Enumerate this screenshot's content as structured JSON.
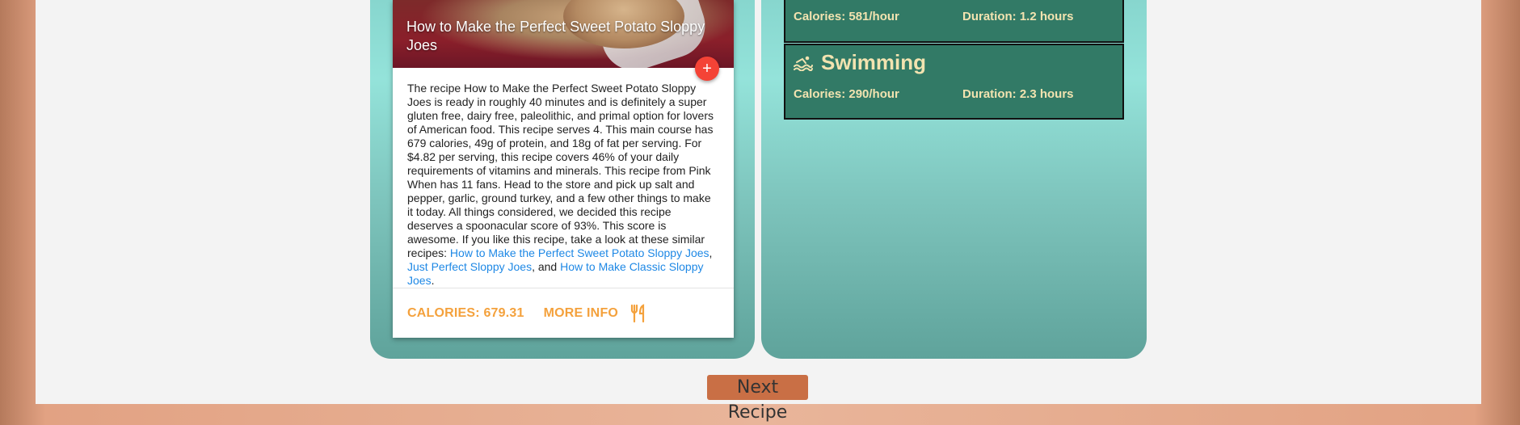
{
  "recipe": {
    "title": "How to Make the Perfect Sweet Potato Sloppy Joes",
    "add_button": "+",
    "summary_text": "The recipe How to Make the Perfect Sweet Potato Sloppy Joes is ready in roughly 40 minutes and is definitely a super gluten free, dairy free, paleolithic, and primal option for lovers of American food. This recipe serves 4. This main course has 679 calories, 49g of protein, and 18g of fat per serving. For $4.82 per serving, this recipe covers 46% of your daily requirements of vitamins and minerals. This recipe from Pink When has 11 fans. Head to the store and pick up salt and pepper, garlic, ground turkey, and a few other things to make it today. All things considered, we decided this recipe deserves a spoonacular score of 93%. This score is awesome. If you like this recipe, take a look at these similar recipes:",
    "similar_links": [
      "How to Make the Perfect Sweet Potato Sloppy Joes",
      "Just Perfect Sloppy Joes",
      "How to Make Classic Sloppy Joes"
    ],
    "sep1": ",",
    "sep2": ", and",
    "sep3": ".",
    "calories_label": "CALORIES: 679.31",
    "more_info_label": "MORE INFO",
    "fork_icon": "fork-knife-icon"
  },
  "exercises": [
    {
      "name": "",
      "calories": "Calories: 581/hour",
      "duration": "Duration: 1.2 hours"
    },
    {
      "name": "Swimming",
      "icon": "swimming-icon",
      "calories": "Calories: 290/hour",
      "duration": "Duration: 2.3 hours"
    }
  ],
  "next_button": "Next Recipe",
  "colors": {
    "accent_orange": "#f4a13c",
    "exercise_bg": "#327a66",
    "exercise_text": "#f2e3b0",
    "fab_red": "#f44336",
    "next_button_bg": "#c96f45",
    "link_blue": "#1e88e5"
  }
}
